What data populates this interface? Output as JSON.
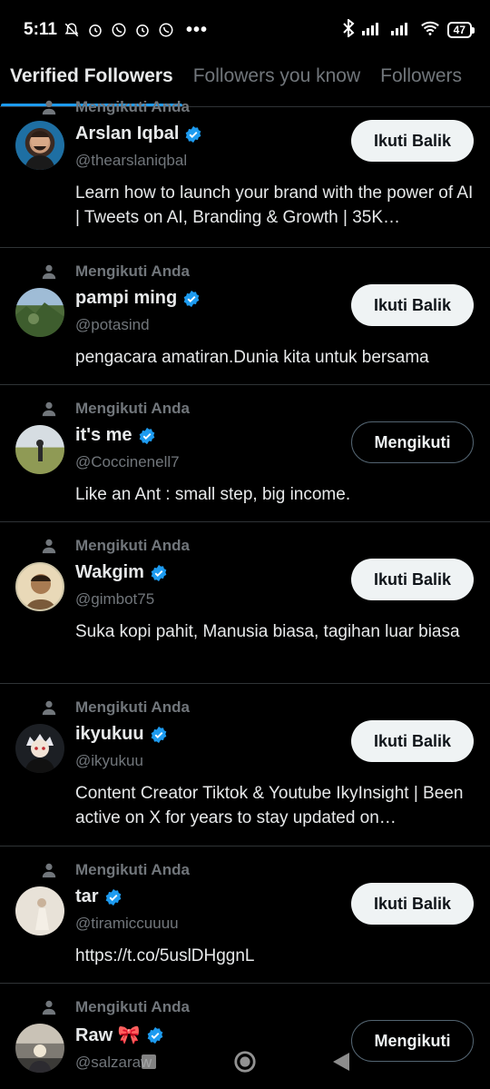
{
  "status_bar": {
    "time": "5:11",
    "battery": "47"
  },
  "tabs": [
    {
      "label": "Verified Followers"
    },
    {
      "label": "Followers you know"
    },
    {
      "label": "Followers"
    }
  ],
  "context_label": "Mengikuti Anda",
  "follow_back_label": "Ikuti Balik",
  "following_label": "Mengikuti",
  "accounts": [
    {
      "name": "Arslan Iqbal",
      "handle": "@thearslaniqbal",
      "bio": "Learn how to launch your brand with the power of AI | Tweets on AI, Branding & Growth | 35K…",
      "button": "Ikuti Balik"
    },
    {
      "name": "pampi ming",
      "handle": "@potasind",
      "bio": "pengacara amatiran.Dunia  kita untuk bersama",
      "button": "Ikuti Balik"
    },
    {
      "name": "it's me",
      "handle": "@Coccinenell7",
      "bio": "Like an Ant : small step, big income.",
      "button": "Mengikuti"
    },
    {
      "name": "Wakgim",
      "handle": "@gimbot75",
      "bio": "Suka kopi pahit, Manusia biasa, tagihan luar biasa",
      "button": "Ikuti Balik"
    },
    {
      "name": "ikyukuu",
      "handle": "@ikyukuu",
      "bio": "Content Creator Tiktok & Youtube IkyInsight | Been active on X for years to stay updated on…",
      "button": "Ikuti Balik"
    },
    {
      "name": "tar",
      "handle": "@tiramiccuuuu",
      "bio": "https://t.co/5uslDHggnL",
      "button": "Ikuti Balik"
    },
    {
      "name": "Raw 🎀",
      "handle": "@salzaraw",
      "bio": "",
      "button": "Mengikuti"
    }
  ],
  "colors": {
    "accent": "#1d9bf0",
    "verified": "#1d9bf0"
  }
}
